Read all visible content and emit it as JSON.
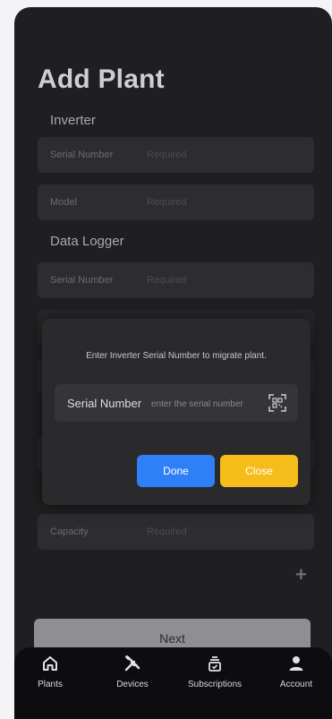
{
  "page": {
    "title": "Add Plant"
  },
  "sections": {
    "inverter": "Inverter",
    "data_logger": "Data Logger"
  },
  "fields": {
    "inverter_serial": {
      "label": "Serial Number",
      "placeholder": "Required"
    },
    "inverter_model": {
      "label": "Model",
      "placeholder": "Required"
    },
    "logger_serial": {
      "label": "Serial Number",
      "placeholder": "Required"
    },
    "capacity": {
      "label": "Capacity",
      "placeholder": "Required"
    }
  },
  "add_symbol": "+",
  "next_label": "Next",
  "modal": {
    "message": "Enter Inverter Serial Number to migrate plant.",
    "field_label": "Serial Number",
    "field_placeholder": "enter the serial number",
    "done_label": "Done",
    "close_label": "Close"
  },
  "tabbar": [
    {
      "label": "Plants",
      "icon": "home-icon"
    },
    {
      "label": "Devices",
      "icon": "tools-icon"
    },
    {
      "label": "Subscriptions",
      "icon": "subscription-icon"
    },
    {
      "label": "Account",
      "icon": "user-icon"
    }
  ],
  "colors": {
    "accent_blue": "#2f80f7",
    "accent_yellow": "#f6bd1a",
    "background": "#1f1f21"
  }
}
